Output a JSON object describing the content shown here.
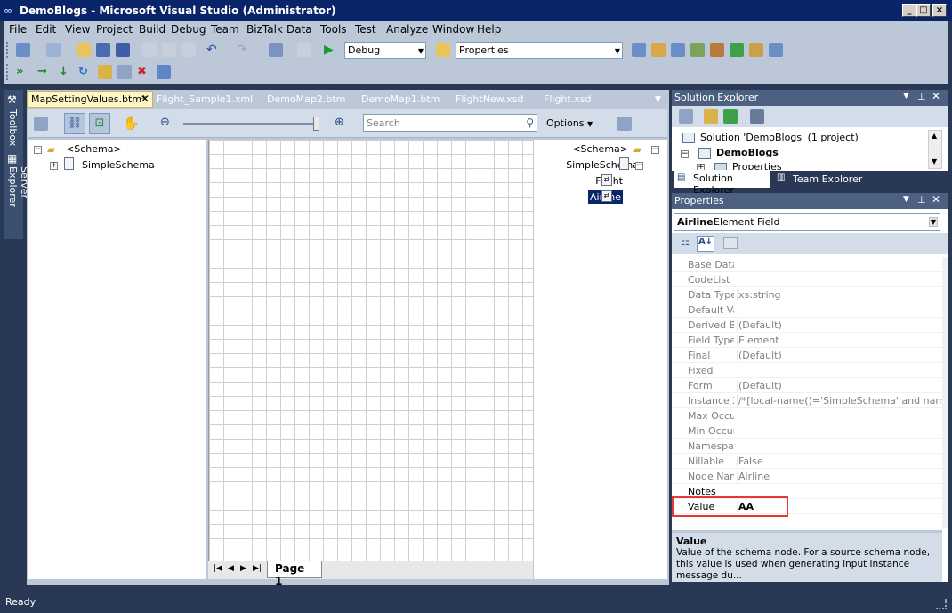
{
  "window": {
    "title": "DemoBlogs - Microsoft Visual Studio (Administrator)"
  },
  "menu": [
    "File",
    "Edit",
    "View",
    "Project",
    "Build",
    "Debug",
    "Team",
    "BizTalk",
    "Data",
    "Tools",
    "Test",
    "Analyze",
    "Window",
    "Help"
  ],
  "toolbar": {
    "config": "Debug",
    "find": "Properties"
  },
  "side_tabs": {
    "toolbox": "Toolbox",
    "server_explorer": "Server Explorer"
  },
  "tabs": [
    "MapSettingValues.btm*",
    "Flight_Sample1.xml",
    "DemoMap2.btm",
    "DemoMap1.btm",
    "FlightNew.xsd",
    "Flight.xsd"
  ],
  "mapper": {
    "search_placeholder": "Search",
    "options_label": "Options",
    "source": {
      "root": "<Schema>",
      "child": "SimpleSchema"
    },
    "destination": {
      "root": "<Schema>",
      "child": "SimpleSchema",
      "field1": "Flight",
      "field2": "Airline"
    },
    "page_tab": "Page 1"
  },
  "solution_explorer": {
    "title": "Solution Explorer",
    "solution": "Solution 'DemoBlogs' (1 project)",
    "project": "DemoBlogs",
    "properties_node": "Properties",
    "tab_solution": "Solution Explorer",
    "tab_team": "Team Explorer"
  },
  "properties": {
    "title": "Properties",
    "object_name": "Airline",
    "object_type": "Element Field",
    "rows": [
      {
        "key": "Base Data",
        "value": ""
      },
      {
        "key": "CodeList",
        "value": ""
      },
      {
        "key": "Data Type",
        "value": "xs:string"
      },
      {
        "key": "Default Va",
        "value": ""
      },
      {
        "key": "Derived By",
        "value": "(Default)"
      },
      {
        "key": "Field Type",
        "value": "Element"
      },
      {
        "key": "Final",
        "value": "(Default)"
      },
      {
        "key": "Fixed",
        "value": ""
      },
      {
        "key": "Form",
        "value": "(Default)"
      },
      {
        "key": "Instance X",
        "value": "/*[local-name()='SimpleSchema' and namespace"
      },
      {
        "key": "Max Occur",
        "value": ""
      },
      {
        "key": "Min Occurs",
        "value": ""
      },
      {
        "key": "Namespac",
        "value": ""
      },
      {
        "key": "Nillable",
        "value": "False"
      },
      {
        "key": "Node Nam",
        "value": "Airline"
      },
      {
        "key": "Notes",
        "value": ""
      },
      {
        "key": "Value",
        "value": "AA"
      }
    ],
    "desc_title": "Value",
    "desc_text": "Value of the schema node. For a source schema node, this value is used when generating input instance message du..."
  },
  "status": {
    "text": "Ready"
  },
  "colors": {
    "highlight_box": "#e53935",
    "selection": "#0a246a",
    "frame": "#293955"
  }
}
